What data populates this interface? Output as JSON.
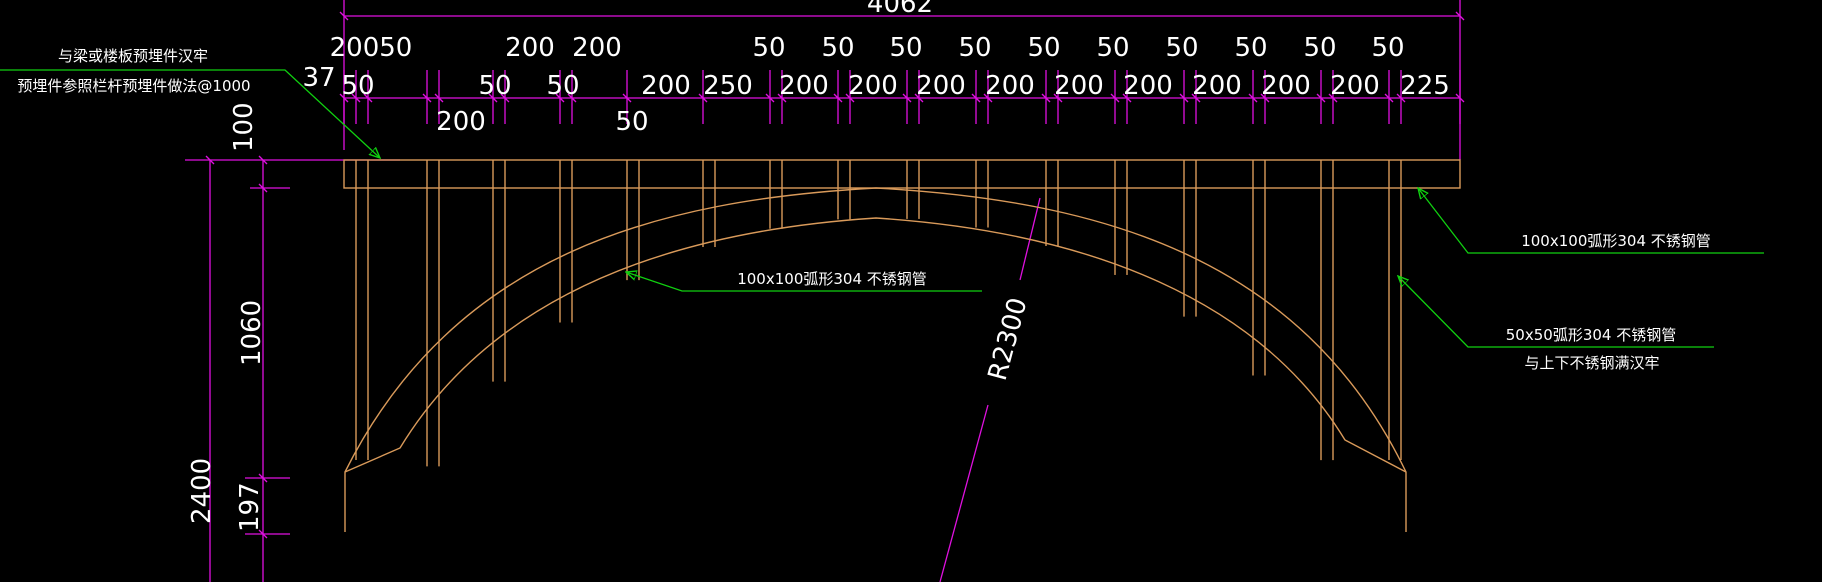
{
  "colors": {
    "background": "#000000",
    "dimension": "#e010e0",
    "structure": "#d99a5a",
    "leader": "#10d010",
    "text": "#ffffff"
  },
  "dims": {
    "overall_width": "4062",
    "top_row": [
      "20050",
      "200",
      "200",
      "50",
      "50",
      "50",
      "50",
      "50",
      "50",
      "50",
      "50",
      "50",
      "50"
    ],
    "mid_row": [
      "37",
      "50",
      "50",
      "50",
      "200",
      "250",
      "200",
      "200",
      "200",
      "200",
      "200",
      "200",
      "200",
      "200",
      "200",
      "225"
    ],
    "low_row": [
      "200",
      "50"
    ],
    "top_height": "100",
    "rail_height": "1060",
    "total_height": "2400",
    "bottom_gap": "197",
    "radius": "R2300"
  },
  "notes": {
    "embed_line1": "与梁或楼板预埋件汉牢",
    "embed_line2": "预埋件参照栏杆预埋件做法@1000",
    "arc_pipe_left": "100x100弧形304 不锈钢管",
    "arc_pipe_right": "100x100弧形304 不锈钢管",
    "post_pipe_line1": "50x50弧形304 不锈钢管",
    "post_pipe_line2": "与上下不锈钢满汉牢"
  }
}
